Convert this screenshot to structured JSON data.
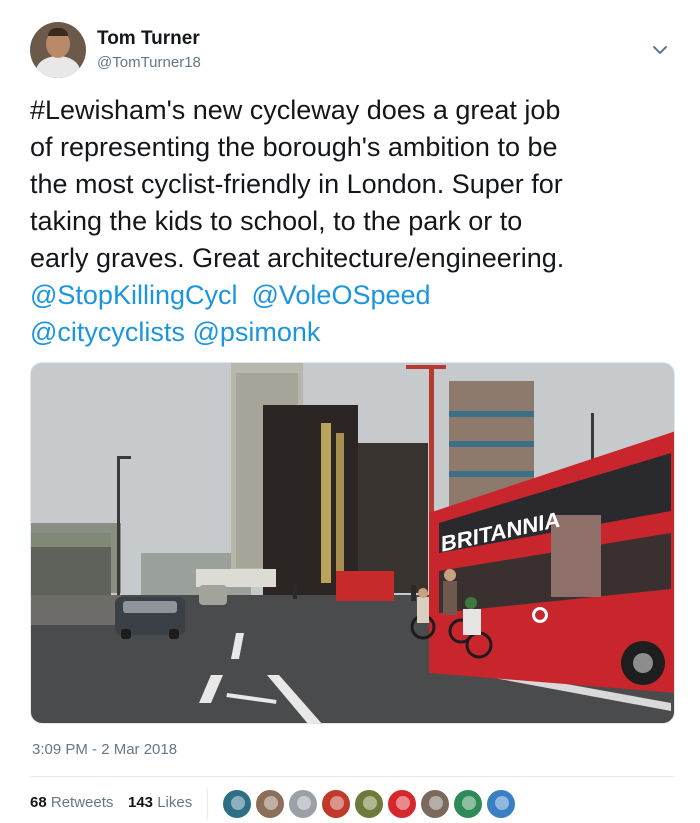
{
  "author": {
    "name": "Tom Turner",
    "handle": "@TomTurner18"
  },
  "tweet": {
    "lines": [
      "#Lewisham's new cycleway does a great job",
      "of representing the  borough's ambition to be",
      "the most cyclist-friendly in London. Super for",
      "taking the kids to school, to the park or to",
      "early graves. Great architecture/engineering."
    ],
    "mentions": [
      "@StopKillingCycl",
      "@VoleOSpeed",
      "@citycyclists",
      "@psimonk"
    ]
  },
  "photo": {
    "bus_signage": "BRITANNIA",
    "description_icon": "photo-street-scene"
  },
  "timestamp": "3:09 PM - 2 Mar 2018",
  "stats": {
    "retweets_count": "68",
    "retweets_label": "Retweets",
    "likes_count": "143",
    "likes_label": "Likes"
  },
  "likers": [
    {
      "color": "#2f6f86"
    },
    {
      "color": "#8c6f5a"
    },
    {
      "color": "#9aa0a6"
    },
    {
      "color": "#c0392b"
    },
    {
      "color": "#6d7a3a"
    },
    {
      "color": "#d6282c"
    },
    {
      "color": "#7a6a5e"
    },
    {
      "color": "#2e8b57"
    },
    {
      "color": "#3a7fc2"
    }
  ],
  "colors": {
    "link": "#1b95e0",
    "secondary_text": "#657786",
    "primary_text": "#14171a"
  }
}
